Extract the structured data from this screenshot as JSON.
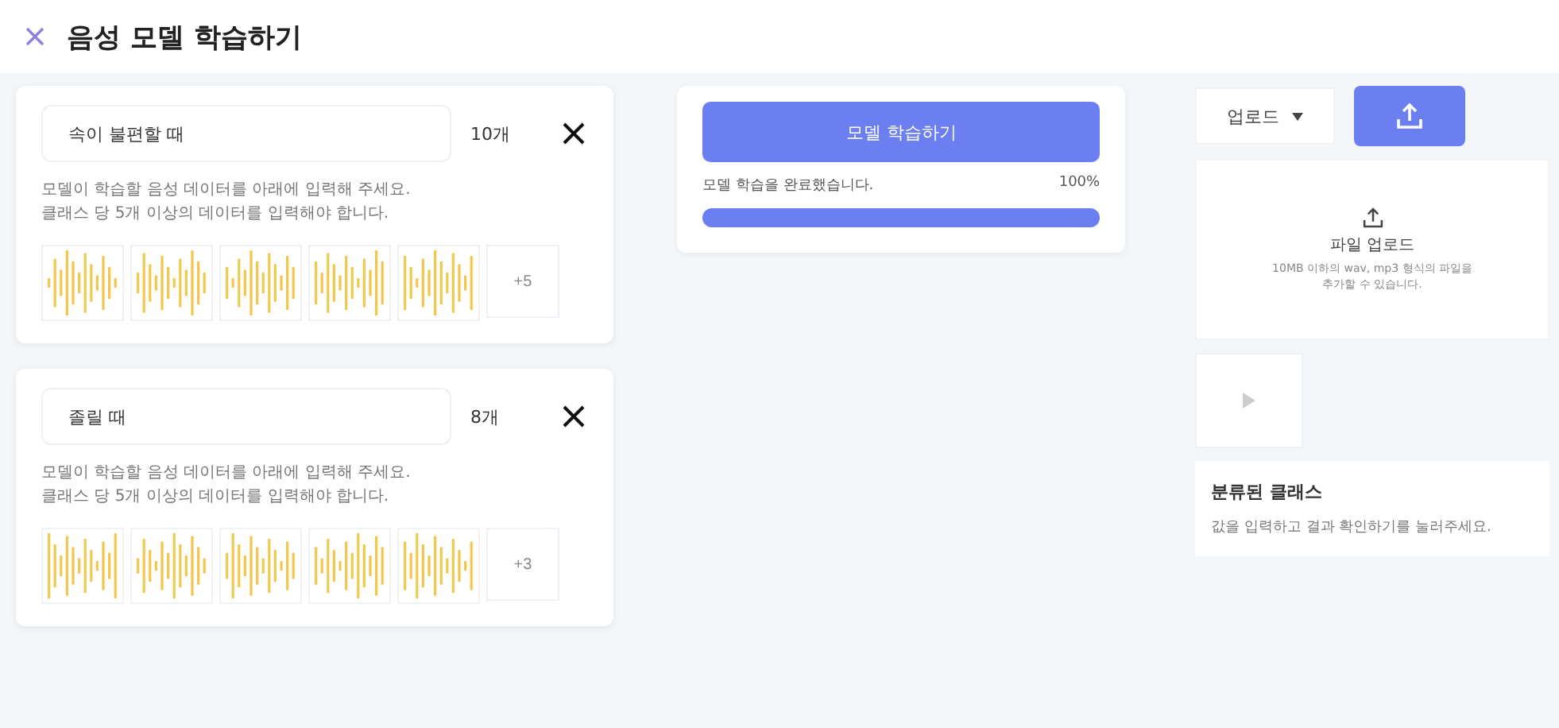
{
  "header": {
    "title": "음성 모델 학습하기"
  },
  "classes": [
    {
      "name": "속이 불편할 때",
      "count": "10개",
      "description": "모델이 학습할 음성 데이터를 아래에 입력해 주세요.\n클래스 당 5개 이상의 데이터를 입력해야 합니다.",
      "more": "+5"
    },
    {
      "name": "졸릴 때",
      "count": "8개",
      "description": "모델이 학습할 음성 데이터를 아래에 입력해 주세요.\n클래스 당 5개 이상의 데이터를 입력해야 합니다.",
      "more": "+3"
    }
  ],
  "training": {
    "button": "모델 학습하기",
    "status": "모델 학습을 완료했습니다.",
    "percent": "100%",
    "level": 1
  },
  "test": {
    "mode": "업로드",
    "upload_title": "파일 업로드",
    "upload_hint": "10MB 이하의 wav, mp3 형식의 파일을\n추가할 수 있습니다.",
    "result_title": "분류된 클래스",
    "result_hint": "값을 입력하고 결과 확인하기를 눌러주세요."
  }
}
